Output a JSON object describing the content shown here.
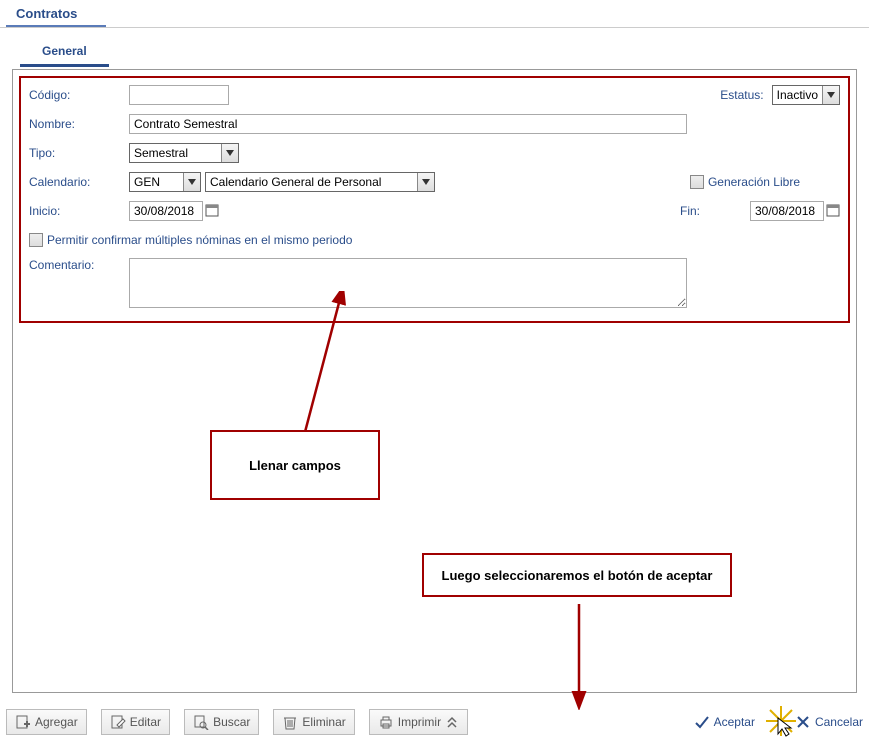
{
  "module_title": "Contratos",
  "tabs": {
    "general": "General"
  },
  "form": {
    "codigo_label": "Código:",
    "codigo_value": "",
    "estatus_label": "Estatus:",
    "estatus_value": "Inactivo",
    "nombre_label": "Nombre:",
    "nombre_value": "Contrato Semestral",
    "tipo_label": "Tipo:",
    "tipo_value": "Semestral",
    "calendario_label": "Calendario:",
    "calendario_code": "GEN",
    "calendario_desc": "Calendario General de Personal",
    "generacion_libre_label": "Generación Libre",
    "inicio_label": "Inicio:",
    "inicio_value": "30/08/2018",
    "fin_label": "Fin:",
    "fin_value": "30/08/2018",
    "permitir_multiples_label": "Permitir confirmar múltiples nóminas en el mismo periodo",
    "comentario_label": "Comentario:",
    "comentario_value": ""
  },
  "annotations": {
    "llenar_campos": "Llenar campos",
    "luego_aceptar": "Luego seleccionaremos el botón de aceptar"
  },
  "toolbar": {
    "agregar": "Agregar",
    "editar": "Editar",
    "buscar": "Buscar",
    "eliminar": "Eliminar",
    "imprimir": "Imprimir",
    "aceptar": "Aceptar",
    "cancelar": "Cancelar"
  }
}
